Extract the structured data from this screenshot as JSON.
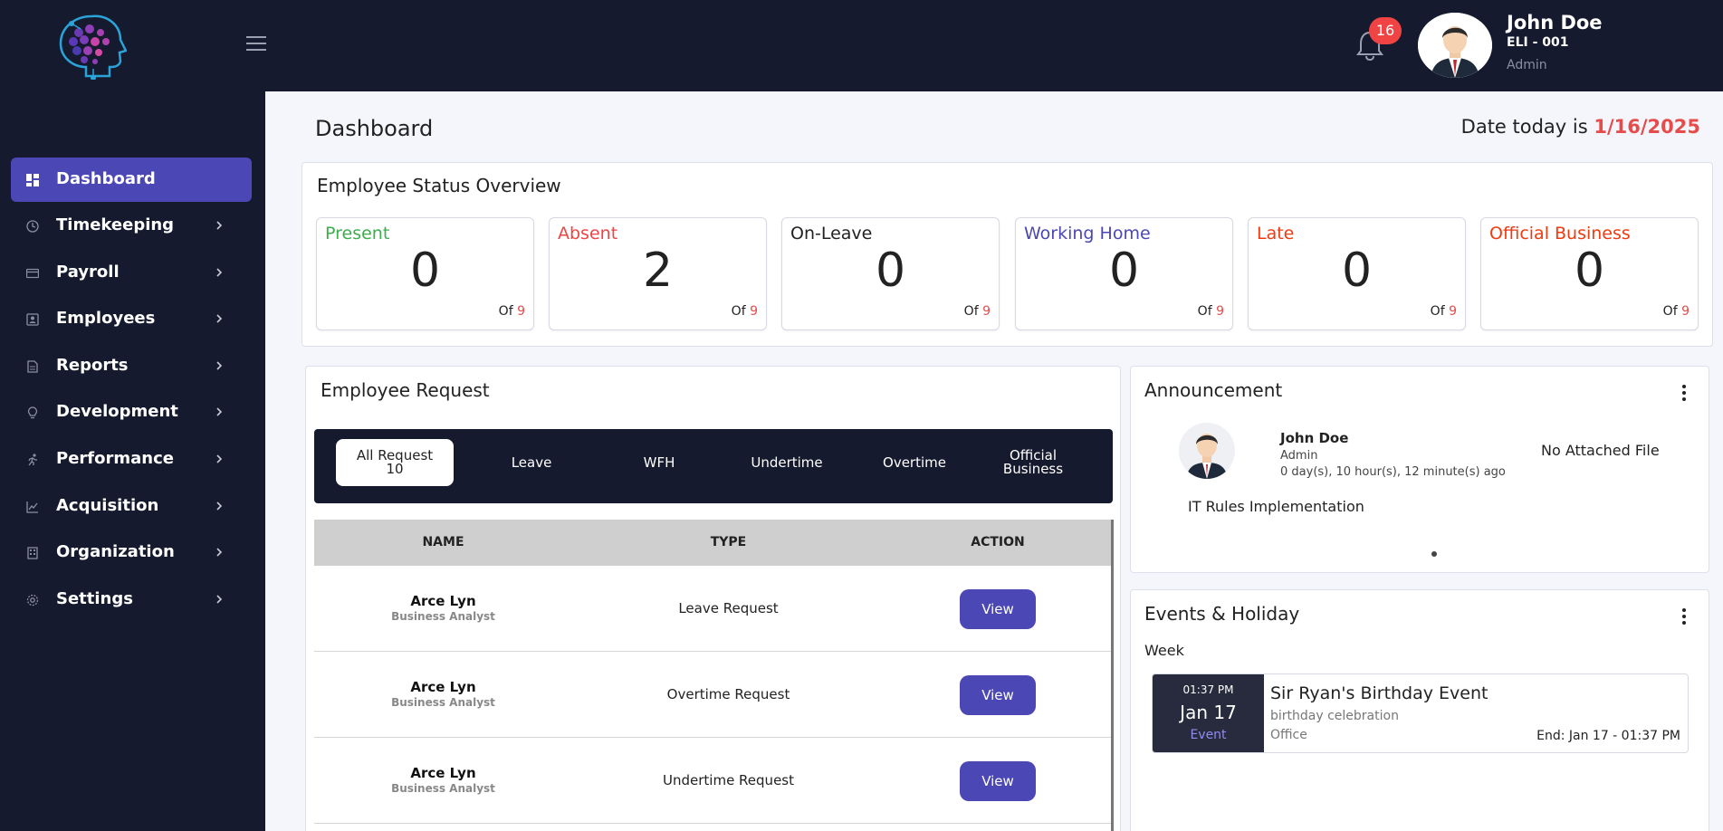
{
  "header": {
    "notification_count": "16",
    "user": {
      "name": "John Doe",
      "id": "ELI - 001",
      "role": "Admin"
    }
  },
  "sidebar": {
    "items": [
      {
        "label": "Dashboard",
        "icon": "dashboard-icon",
        "active": true
      },
      {
        "label": "Timekeeping",
        "icon": "clock-icon"
      },
      {
        "label": "Payroll",
        "icon": "card-icon"
      },
      {
        "label": "Employees",
        "icon": "id-badge-icon"
      },
      {
        "label": "Reports",
        "icon": "document-icon"
      },
      {
        "label": "Development",
        "icon": "lightbulb-icon"
      },
      {
        "label": "Performance",
        "icon": "running-icon"
      },
      {
        "label": "Acquisition",
        "icon": "line-chart-icon"
      },
      {
        "label": "Organization",
        "icon": "building-icon"
      },
      {
        "label": "Settings",
        "icon": "gear-icon"
      }
    ]
  },
  "page": {
    "title": "Dashboard",
    "date_prefix": "Date today is",
    "date_value": "1/16/2025"
  },
  "status_overview": {
    "title": "Employee Status Overview",
    "of_label": "Of",
    "items": [
      {
        "label": "Present",
        "count": "0",
        "total": "9",
        "color": "#3cae4c"
      },
      {
        "label": "Absent",
        "count": "2",
        "total": "9",
        "color": "#ef4444"
      },
      {
        "label": "On-Leave",
        "count": "0",
        "total": "9",
        "color": "#222222"
      },
      {
        "label": "Working Home",
        "count": "0",
        "total": "9",
        "color": "#4b47b4"
      },
      {
        "label": "Late",
        "count": "0",
        "total": "9",
        "color": "#ef3b10"
      },
      {
        "label": "Official Business",
        "count": "0",
        "total": "9",
        "color": "#ef3b10"
      }
    ]
  },
  "requests": {
    "title": "Employee Request",
    "tabs": [
      {
        "label": "All Request",
        "count": "10",
        "active": true
      },
      {
        "label": "Leave"
      },
      {
        "label": "WFH"
      },
      {
        "label": "Undertime"
      },
      {
        "label": "Overtime"
      },
      {
        "label": "Official Business"
      }
    ],
    "columns": [
      "NAME",
      "TYPE",
      "ACTION"
    ],
    "rows": [
      {
        "name": "Arce Lyn",
        "role": "Business Analyst",
        "type": "Leave Request",
        "action": "View"
      },
      {
        "name": "Arce Lyn",
        "role": "Business Analyst",
        "type": "Overtime Request",
        "action": "View"
      },
      {
        "name": "Arce Lyn",
        "role": "Business Analyst",
        "type": "Undertime Request",
        "action": "View"
      }
    ]
  },
  "announcement": {
    "title": "Announcement",
    "author": "John Doe",
    "author_role": "Admin",
    "time_ago": "0 day(s), 10 hour(s), 12 minute(s) ago",
    "attachment": "No Attached File",
    "subject": "IT Rules Implementation"
  },
  "events": {
    "title": "Events & Holiday",
    "period": "Week",
    "items": [
      {
        "time": "01:37 PM",
        "date": "Jan 17",
        "kind": "Event",
        "name": "Sir Ryan's Birthday Event",
        "description": "birthday celebration",
        "location": "Office",
        "end": "End: Jan 17 - 01:37 PM"
      }
    ]
  },
  "colors": {
    "dark_bg": "#161a2e",
    "accent": "#4b47b4",
    "danger": "#e74c4c",
    "page_bg": "#f4f6fb"
  }
}
